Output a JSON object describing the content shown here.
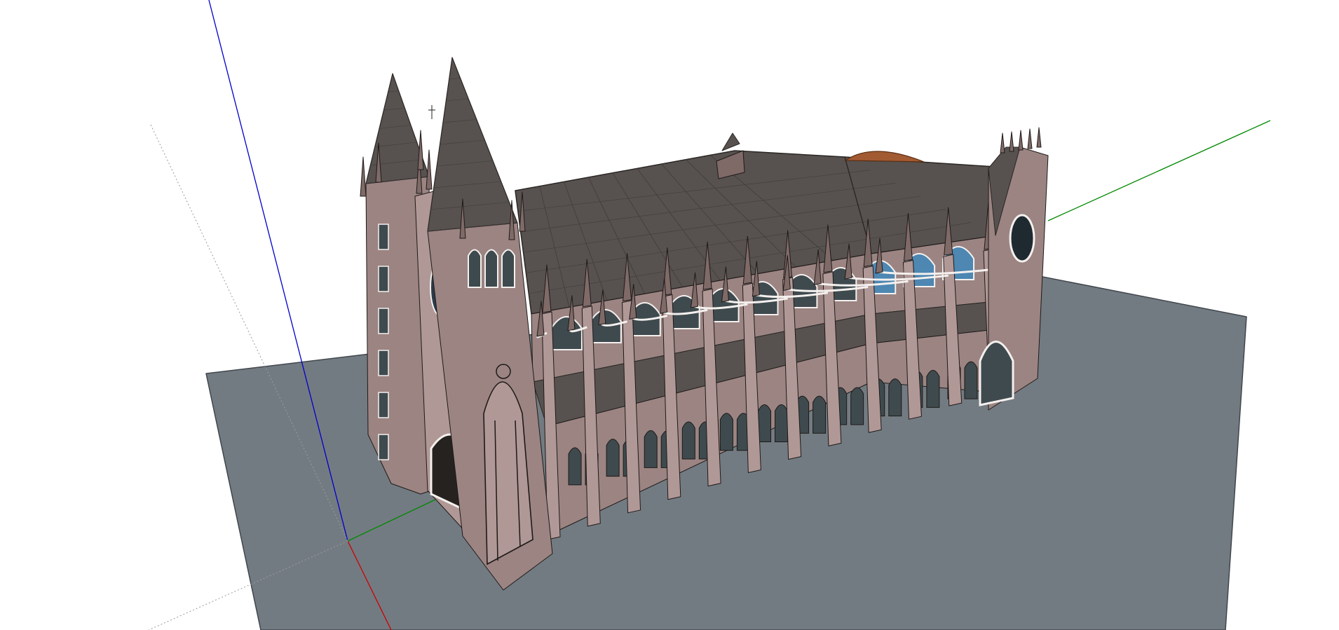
{
  "app": {
    "view": "3d-model-viewport"
  },
  "colors": {
    "background": "#ffffff",
    "ground": "#737b82",
    "ground_edge": "#40464c",
    "wall": "#9b8482",
    "wall_light": "#b09896",
    "wall_dark": "#7f6a68",
    "roof": "#57524f",
    "roof_dark": "#403c3a",
    "roof_line": "#2a2624",
    "window": "#3e4a4e",
    "window_blue": "#4d87b2",
    "trim": "#f4f0ee",
    "dome": "#a25a32",
    "axis_red": "#cc0000",
    "axis_green": "#008800",
    "axis_blue": "#0000cc",
    "dotted_axis": "#9a9a9a"
  },
  "scene": {
    "model_name": "",
    "objects": [
      "ground-plane",
      "gothic-cathedral",
      "rose-window",
      "twin-spires",
      "flying-buttresses",
      "roof-dome"
    ]
  }
}
